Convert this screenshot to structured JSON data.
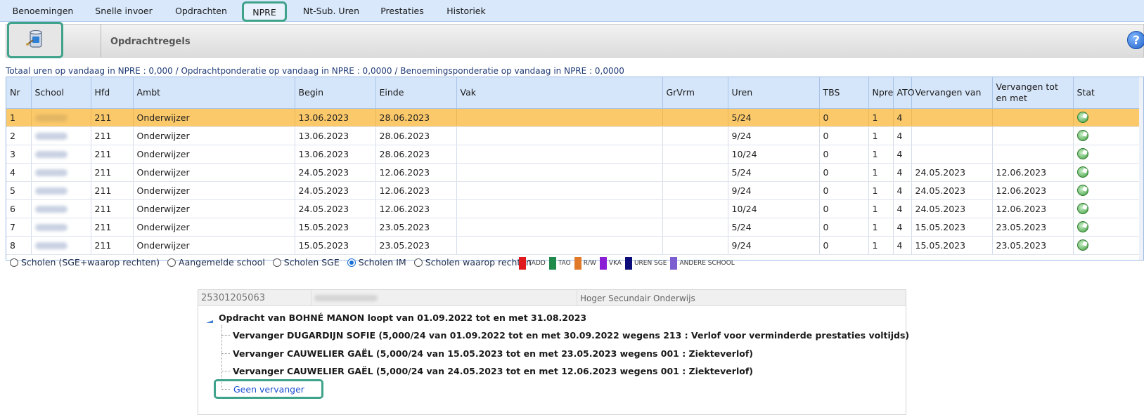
{
  "tabs": [
    {
      "label": "Benoemingen",
      "active": false
    },
    {
      "label": "Snelle invoer",
      "active": false
    },
    {
      "label": "Opdrachten",
      "active": false
    },
    {
      "label": "NPRE",
      "active": true
    },
    {
      "label": "Nt-Sub. Uren",
      "active": false
    },
    {
      "label": "Prestaties",
      "active": false
    },
    {
      "label": "Historiek",
      "active": false
    }
  ],
  "toolbar": {
    "title": "Opdrachtregels",
    "help_label": "?"
  },
  "totals_text": "Totaal uren op vandaag in NPRE : 0,000 / Opdrachtponderatie op vandaag in NPRE : 0,0000 / Benoemingsponderatie op vandaag in NPRE : 0,0000",
  "table": {
    "columns": [
      "Nr",
      "School",
      "Hfd",
      "Ambt",
      "Begin",
      "Einde",
      "Vak",
      "GrVrm",
      "Uren",
      "TBS",
      "Npre",
      "ATO",
      "Vervangen van",
      "Vervangen tot en met",
      "Stat"
    ],
    "rows": [
      {
        "nr": "1",
        "hfd": "211",
        "ambt": "Onderwijzer",
        "begin": "13.06.2023",
        "einde": "28.06.2023",
        "vak": "",
        "grvrm": "",
        "uren": "5/24",
        "tbs": "0",
        "npre": "1",
        "ato": "4",
        "vervangen_van": "",
        "vervangen_tot": "",
        "selected": true
      },
      {
        "nr": "2",
        "hfd": "211",
        "ambt": "Onderwijzer",
        "begin": "13.06.2023",
        "einde": "28.06.2023",
        "vak": "",
        "grvrm": "",
        "uren": "9/24",
        "tbs": "0",
        "npre": "1",
        "ato": "4",
        "vervangen_van": "",
        "vervangen_tot": "",
        "selected": false
      },
      {
        "nr": "3",
        "hfd": "211",
        "ambt": "Onderwijzer",
        "begin": "13.06.2023",
        "einde": "28.06.2023",
        "vak": "",
        "grvrm": "",
        "uren": "10/24",
        "tbs": "0",
        "npre": "1",
        "ato": "4",
        "vervangen_van": "",
        "vervangen_tot": "",
        "selected": false
      },
      {
        "nr": "4",
        "hfd": "211",
        "ambt": "Onderwijzer",
        "begin": "24.05.2023",
        "einde": "12.06.2023",
        "vak": "",
        "grvrm": "",
        "uren": "5/24",
        "tbs": "0",
        "npre": "1",
        "ato": "4",
        "vervangen_van": "24.05.2023",
        "vervangen_tot": "12.06.2023",
        "selected": false
      },
      {
        "nr": "5",
        "hfd": "211",
        "ambt": "Onderwijzer",
        "begin": "24.05.2023",
        "einde": "12.06.2023",
        "vak": "",
        "grvrm": "",
        "uren": "9/24",
        "tbs": "0",
        "npre": "1",
        "ato": "4",
        "vervangen_van": "24.05.2023",
        "vervangen_tot": "12.06.2023",
        "selected": false
      },
      {
        "nr": "6",
        "hfd": "211",
        "ambt": "Onderwijzer",
        "begin": "24.05.2023",
        "einde": "12.06.2023",
        "vak": "",
        "grvrm": "",
        "uren": "10/24",
        "tbs": "0",
        "npre": "1",
        "ato": "4",
        "vervangen_van": "24.05.2023",
        "vervangen_tot": "12.06.2023",
        "selected": false
      },
      {
        "nr": "7",
        "hfd": "211",
        "ambt": "Onderwijzer",
        "begin": "15.05.2023",
        "einde": "23.05.2023",
        "vak": "",
        "grvrm": "",
        "uren": "5/24",
        "tbs": "0",
        "npre": "1",
        "ato": "4",
        "vervangen_van": "15.05.2023",
        "vervangen_tot": "23.05.2023",
        "selected": false
      },
      {
        "nr": "8",
        "hfd": "211",
        "ambt": "Onderwijzer",
        "begin": "15.05.2023",
        "einde": "23.05.2023",
        "vak": "",
        "grvrm": "",
        "uren": "9/24",
        "tbs": "0",
        "npre": "1",
        "ato": "4",
        "vervangen_van": "15.05.2023",
        "vervangen_tot": "23.05.2023",
        "selected": false
      }
    ]
  },
  "filters": {
    "options": [
      {
        "label": "Scholen (SGE+waarop rechten)",
        "checked": false
      },
      {
        "label": "Aangemelde school",
        "checked": false
      },
      {
        "label": "Scholen SGE",
        "checked": false
      },
      {
        "label": "Scholen IM",
        "checked": true
      },
      {
        "label": "Scholen waarop rechten",
        "checked": false
      }
    ]
  },
  "legend": [
    {
      "label": "TADD",
      "color": "#e0191f"
    },
    {
      "label": "TAO",
      "color": "#1f8a4c"
    },
    {
      "label": "R/W",
      "color": "#e07a2a"
    },
    {
      "label": "VKA",
      "color": "#8b1fd6"
    },
    {
      "label": "UREN SGE",
      "color": "#0b0b7a"
    },
    {
      "label": "ANDERE SCHOOL",
      "color": "#7b5fd0"
    }
  ],
  "tree": {
    "code": "25301205063",
    "level": "Hoger Secundair Onderwijs",
    "root": "Opdracht van BOHNÉ MANON loopt van 01.09.2022 tot en met 31.08.2023",
    "children": [
      "Vervanger DUGARDIJN SOFIE (5,000/24 van 01.09.2022 tot en met 30.09.2022 wegens 213 : Verlof voor verminderde prestaties voltijds)",
      "Vervanger CAUWELIER GAËL (5,000/24 van 15.05.2023 tot en met 23.05.2023 wegens 001 : Ziekteverlof)",
      "Vervanger CAUWELIER GAËL (5,000/24 van 24.05.2023 tot en met 12.06.2023 wegens 001 : Ziekteverlof)"
    ],
    "link": "Geen vervanger"
  }
}
